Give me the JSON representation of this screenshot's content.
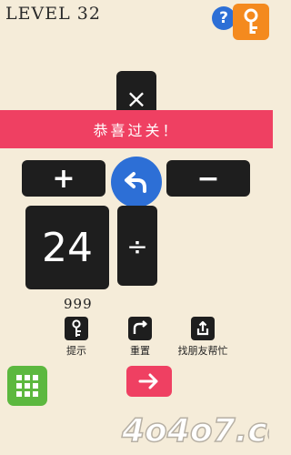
{
  "header": {
    "level_label": "LEVEL 32",
    "help_symbol": "?"
  },
  "board": {
    "tile_top_symbol": "×",
    "plus_symbol": "+",
    "minus_symbol": "−",
    "number_value": "24",
    "divide_symbol": "÷"
  },
  "banner": {
    "text": "恭喜过关！"
  },
  "tools": {
    "hint_count": "999",
    "hint_label": "提示",
    "reset_label": "重置",
    "friend_label": "找朋友帮忙"
  },
  "watermark": {
    "text": "4o4o7.com"
  },
  "colors": {
    "background": "#f5ecd9",
    "tile": "#1e1e1e",
    "blue": "#2d6fd6",
    "pink": "#ef4062",
    "orange": "#f48a1e",
    "green": "#5cb83f"
  },
  "icons": [
    "help-icon",
    "key-icon",
    "undo-icon",
    "hint-key-icon",
    "reset-icon",
    "share-icon",
    "grid-menu-icon",
    "arrow-right-icon"
  ]
}
